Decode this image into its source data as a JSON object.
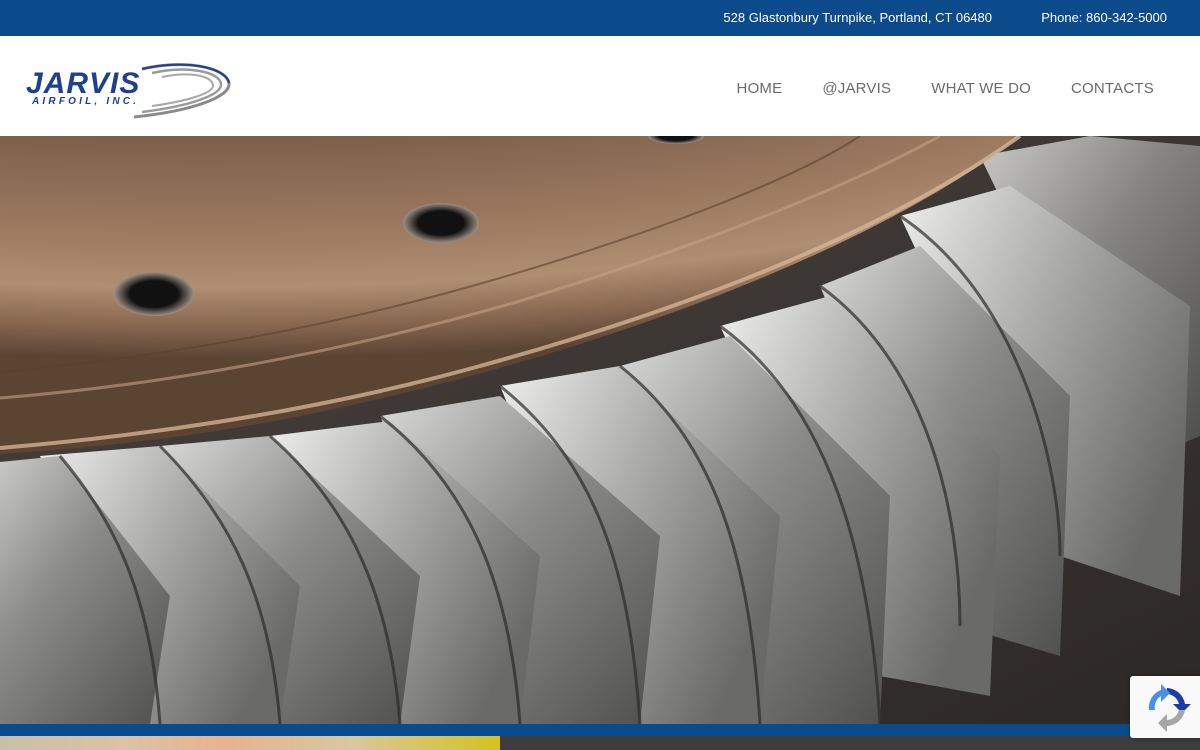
{
  "topbar": {
    "address": "528 Glastonbury Turnpike, Portland, CT 06480",
    "phone": "Phone: 860-342-5000"
  },
  "logo": {
    "name": "JARVIS",
    "tagline": "AIRFOIL, INC."
  },
  "nav": {
    "items": [
      {
        "label": "HOME"
      },
      {
        "label": "@JARVIS"
      },
      {
        "label": "WHAT WE DO"
      },
      {
        "label": "CONTACTS"
      }
    ]
  },
  "colors": {
    "brand_blue": "#0b4a8b",
    "nav_text": "#6b6b6b",
    "logo_blue": "#1f3f8f",
    "logo_gray": "#8a8a8a"
  },
  "icons": {
    "recaptcha": "recaptcha-icon"
  }
}
